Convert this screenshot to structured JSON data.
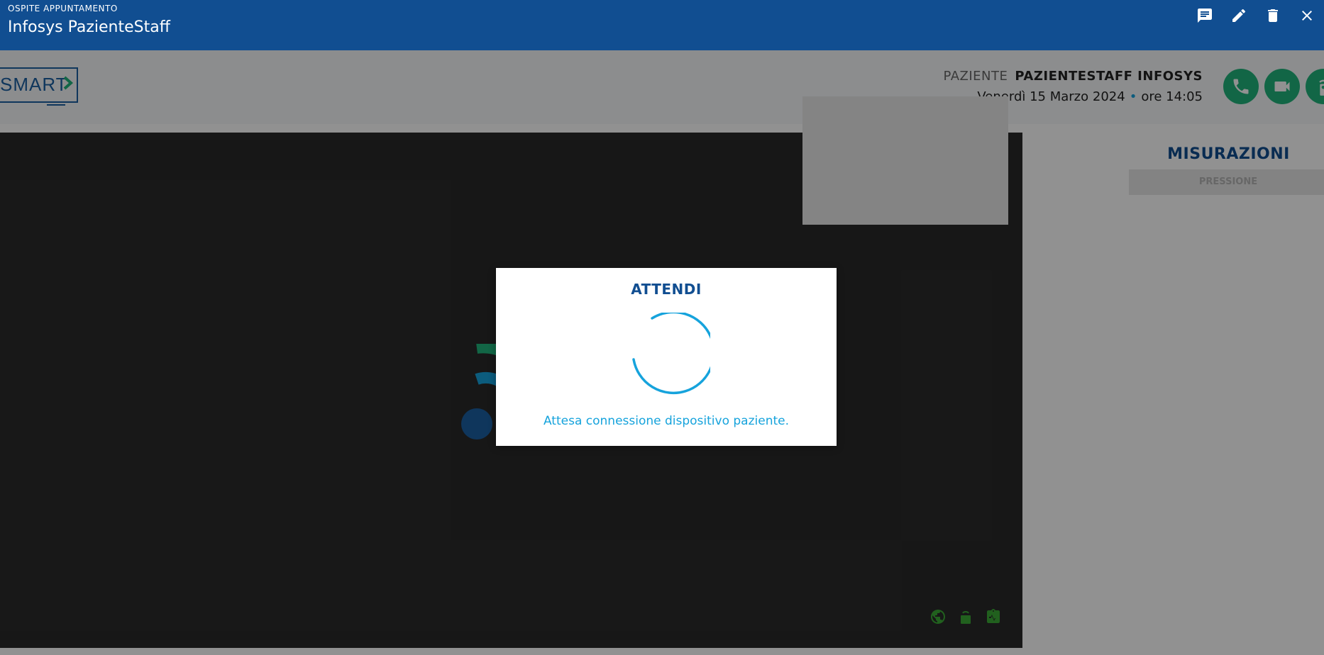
{
  "titlebar": {
    "subtitle": "OSPITE APPUNTAMENTO",
    "title": "Infosys PazienteStaff",
    "actions": [
      {
        "name": "chat-icon"
      },
      {
        "name": "edit-icon"
      },
      {
        "name": "delete-icon"
      },
      {
        "name": "close-icon"
      }
    ]
  },
  "logo": {
    "text": "SMART"
  },
  "patient": {
    "label": "PAZIENTE",
    "name": "PAZIENTESTAFF INFOSYS",
    "date": "Venerdì 15 Marzo 2024",
    "separator": "•",
    "time": "ore 14:05"
  },
  "call_buttons": [
    {
      "name": "phone-icon"
    },
    {
      "name": "video-camera-icon"
    },
    {
      "name": "remote-icon"
    }
  ],
  "video": {
    "bottom_icons": [
      "globe-icon",
      "device-icon",
      "clipboard-pulse-icon"
    ]
  },
  "measurements": {
    "heading": "MISURAZIONI",
    "tab": "PRESSIONE"
  },
  "modal": {
    "title": "ATTENDI",
    "message": "Attesa connessione dispositivo paziente."
  },
  "colors": {
    "primary": "#114e91",
    "accent": "#16a3dc",
    "green": "#21b47b"
  }
}
